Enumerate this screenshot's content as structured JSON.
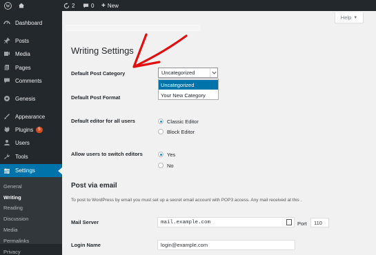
{
  "adminbar": {
    "updates_count": "2",
    "comments_count": "0",
    "new_label": "New"
  },
  "sidebar": {
    "items": [
      {
        "label": "Dashboard",
        "icon": "dashboard-icon"
      },
      {
        "label": "Posts",
        "icon": "pin-icon"
      },
      {
        "label": "Media",
        "icon": "media-icon"
      },
      {
        "label": "Pages",
        "icon": "pages-icon"
      },
      {
        "label": "Comments",
        "icon": "comments-icon"
      },
      {
        "label": "Genesis",
        "icon": "genesis-icon"
      },
      {
        "label": "Appearance",
        "icon": "brush-icon"
      },
      {
        "label": "Plugins",
        "icon": "plugin-icon",
        "badge": "5"
      },
      {
        "label": "Users",
        "icon": "users-icon"
      },
      {
        "label": "Tools",
        "icon": "tools-icon"
      },
      {
        "label": "Settings",
        "icon": "settings-icon"
      }
    ],
    "submenu": [
      "General",
      "Writing",
      "Reading",
      "Discussion",
      "Media",
      "Permalinks",
      "Privacy"
    ]
  },
  "help": {
    "label": "Help"
  },
  "page": {
    "title": "Writing Settings",
    "default_category_label": "Default Post Category",
    "default_category_value": "Uncategorized",
    "category_options": [
      "Uncategorized",
      "Your New Category"
    ],
    "default_format_label": "Default Post Format",
    "default_editor_label": "Default editor for all users",
    "editor_options": [
      "Classic Editor",
      "Block Editor"
    ],
    "switch_editors_label": "Allow users to switch editors",
    "switch_options": [
      "Yes",
      "No"
    ],
    "post_via_email_title": "Post via email",
    "post_via_email_desc": "To post to WordPress by email you must set up a secret email account with POP3 access. Any mail received at this .",
    "mail_server_label": "Mail Server",
    "mail_server_value": "mail.example.com",
    "port_label": "Port",
    "port_value": "110",
    "login_name_label": "Login Name",
    "login_name_value": "login@example.com"
  },
  "colors": {
    "admin_dark": "#23282d",
    "active_blue": "#0073aa",
    "annotation_red": "#e01010"
  }
}
